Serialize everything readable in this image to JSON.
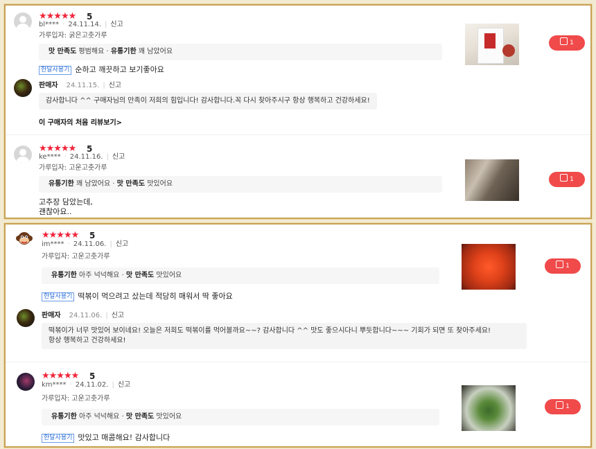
{
  "reviews": [
    {
      "stars": "★★★★★",
      "score": "5",
      "user": "bl****",
      "date": "24.11.14.",
      "report": "신고",
      "option": "가루입자: 굵은고춧가루",
      "eval": [
        {
          "label": "맛 만족도",
          "value": "평범해요"
        },
        {
          "label": "유통기한",
          "value": "꽤 남았어요"
        }
      ],
      "tag": "한달사용기",
      "text": "순하고 깨끗하고 보기좋아요",
      "seller": {
        "name": "판매자",
        "date": "24.11.15.",
        "report": "신고",
        "reply": "감사합니다 ^^ 구매자님의 만족이 저희의 힘입니다! 감사합니다.꼭 다시 찾아주시구 항상 행복하고 건강하세요!"
      },
      "first_review_link": "이 구매자의 처음 리뷰보기>",
      "likes": "1"
    },
    {
      "stars": "★★★★★",
      "score": "5",
      "user": "ke****",
      "date": "24.11.16.",
      "report": "신고",
      "option": "가루입자: 고운고춧가루",
      "eval": [
        {
          "label": "유통기한",
          "value": "꽤 남았어요"
        },
        {
          "label": "맛 만족도",
          "value": "맛있어요"
        }
      ],
      "text_lines": [
        "고추장 담았는데,",
        "괜찮아요.."
      ],
      "likes": "1"
    },
    {
      "stars": "★★★★★",
      "score": "5",
      "user": "im****",
      "date": "24.11.06.",
      "report": "신고",
      "option": "가루입자: 고운고춧가루",
      "eval": [
        {
          "label": "유통기한",
          "value": "아주 넉넉해요"
        },
        {
          "label": "맛 만족도",
          "value": "맛있어요"
        }
      ],
      "tag": "한달사용기",
      "text": "떡볶이 먹으려고 샀는데 적당히 매워서 딱 좋아요",
      "seller": {
        "name": "판매자",
        "date": "24.11.06.",
        "report": "신고",
        "reply_lines": [
          "떡볶이가 너무 맛있어 보이네요! 오늘은 저희도 떡볶이를 먹어볼까요~~? 감사합니다 ^^ 맛도 좋으시다니 뿌듯합니다~~~ 기회가 되면 또 찾아주세요!",
          "항상 행복하고 건강하세요!"
        ]
      },
      "likes": "1"
    },
    {
      "stars": "★★★★★",
      "score": "5",
      "user": "km****",
      "date": "24.11.02.",
      "report": "신고",
      "option": "가루입자: 고운고춧가루",
      "eval": [
        {
          "label": "유통기한",
          "value": "아주 넉넉해요"
        },
        {
          "label": "맛 만족도",
          "value": "맛있어요"
        }
      ],
      "tag": "한달사용기",
      "text": "맛있고 매콤해요! 감사합니다",
      "likes": "1"
    }
  ]
}
